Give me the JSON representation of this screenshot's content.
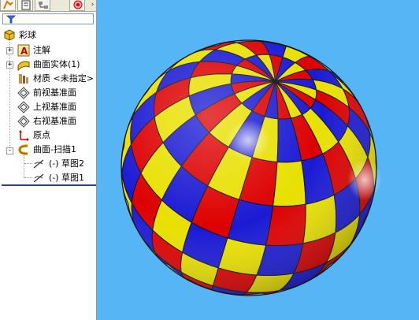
{
  "tree": {
    "part_name": "彩球",
    "items": [
      {
        "label": "注解"
      },
      {
        "label": "曲面实体(1)"
      },
      {
        "label": "材质 <未指定>"
      },
      {
        "label": "前视基准面"
      },
      {
        "label": "上视基准面"
      },
      {
        "label": "右视基准面"
      },
      {
        "label": "原点"
      },
      {
        "label": "曲面-扫描1"
      },
      {
        "label": "(-) 草图2"
      },
      {
        "label": "(-) 草图1"
      }
    ],
    "expander_symbols": {
      "collapsed": "+",
      "expanded": "-"
    }
  },
  "tabbar": {
    "more_symbol": "›"
  },
  "viewport": {
    "background": "#55b5f5",
    "ball_colors": {
      "red": "#dd0000",
      "yellow": "#e8e000",
      "blue": "#1a1ad4",
      "seam": "#111111"
    }
  }
}
